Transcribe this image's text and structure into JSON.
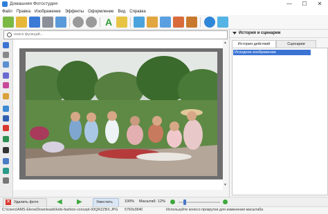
{
  "window": {
    "title": "Домашняя Фотостудия",
    "minimize": "—",
    "maximize": "☐",
    "close": "✕"
  },
  "menu": [
    "Файл",
    "Правка",
    "Изображение",
    "Эффекты",
    "Оформление",
    "Вид",
    "Справка"
  ],
  "search": {
    "placeholder": "поиск функций..."
  },
  "right_panel": {
    "header": "История и сценарии",
    "tabs": [
      "История действий",
      "Сценарии"
    ],
    "history": [
      "Исходное изображение"
    ]
  },
  "bottom": {
    "delete_label": "Удалить фото",
    "shrink_label": "Уместить",
    "zoom_100": "100%",
    "scale_label": "Масштаб:",
    "scale_value": "12%",
    "scale_fraction": 0.12
  },
  "status": {
    "path": "C:\\Users\\AMS-Elena\\Downloads\\kids-fashion-concept-93QRZZBX.JPG",
    "dimensions": "5760x3840",
    "hint": "Используйте колесо прокрутки для изменения масштаба"
  },
  "colors": {
    "accent": "#3b73d3",
    "delete_red": "#d93a2f",
    "arrow_green": "#3ea83e"
  }
}
